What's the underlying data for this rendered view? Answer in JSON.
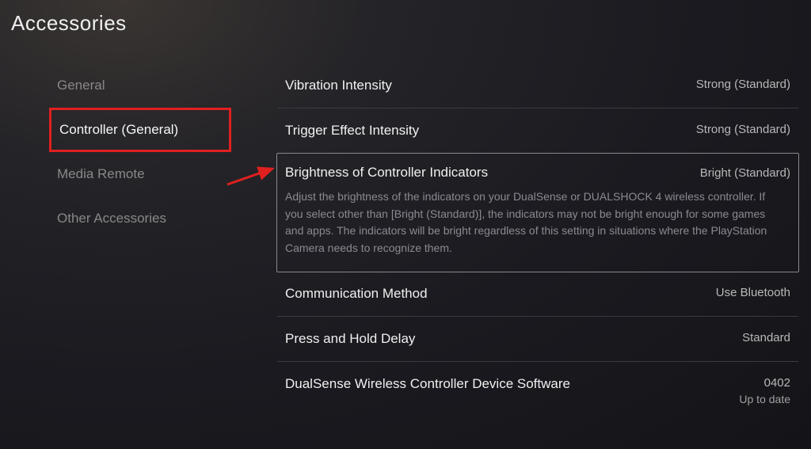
{
  "page_title": "Accessories",
  "sidebar": {
    "items": [
      {
        "label": "General",
        "active": false
      },
      {
        "label": "Controller (General)",
        "active": true
      },
      {
        "label": "Media Remote",
        "active": false
      },
      {
        "label": "Other Accessories",
        "active": false
      }
    ]
  },
  "settings": [
    {
      "label": "Vibration Intensity",
      "value": "Strong (Standard)",
      "focused": false
    },
    {
      "label": "Trigger Effect Intensity",
      "value": "Strong (Standard)",
      "focused": false
    },
    {
      "label": "Brightness of Controller Indicators",
      "value": "Bright (Standard)",
      "focused": true,
      "description": "Adjust the brightness of the indicators on your DualSense or DUALSHOCK 4 wireless controller. If you select other than [Bright (Standard)], the indicators may not be bright enough for some games and apps. The indicators will be bright regardless of this setting in situations where the PlayStation Camera needs to recognize them."
    },
    {
      "label": "Communication Method",
      "value": "Use Bluetooth",
      "focused": false
    },
    {
      "label": "Press and Hold Delay",
      "value": "Standard",
      "focused": false
    },
    {
      "label": "DualSense Wireless Controller Device Software",
      "value": "0402",
      "value_sub": "Up to date",
      "focused": false
    }
  ],
  "annotation": {
    "highlight_color": "#e02020",
    "arrow_color": "#e02020"
  }
}
